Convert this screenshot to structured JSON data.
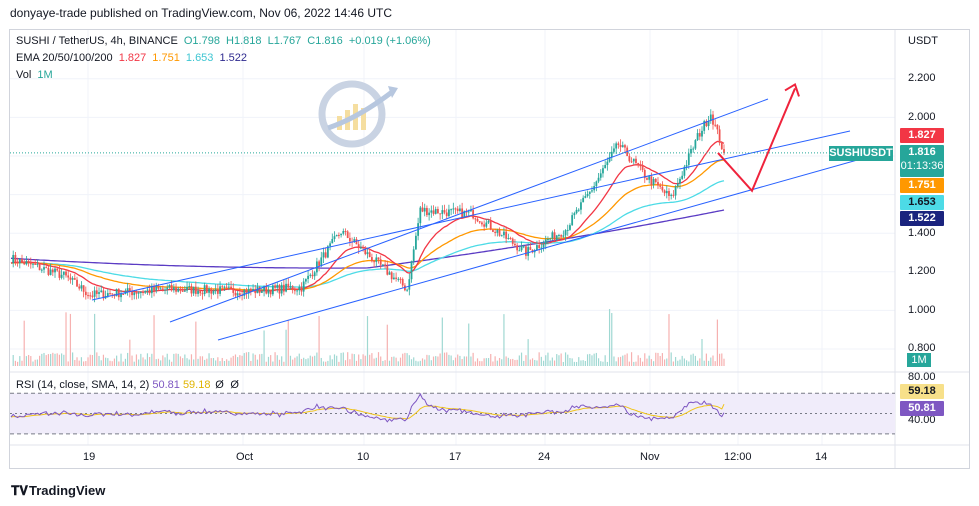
{
  "header": {
    "published": "donyaye-trade published on TradingView.com, Nov 06, 2022 14:46 UTC"
  },
  "legend": {
    "symbol": "SUSHI / TetherUS, 4h, BINANCE",
    "o": "O1.798",
    "h": "H1.818",
    "l": "L1.767",
    "c": "C1.816",
    "chg": "+0.019 (+1.06%)",
    "ema_label": "EMA 20/50/100/200",
    "ema20": "1.827",
    "ema50": "1.751",
    "ema100": "1.653",
    "ema200": "1.522",
    "vol_label": "Vol",
    "vol_value": "1M"
  },
  "rsi_legend": {
    "label": "RSI (14, close, SMA, 14, 2)",
    "rsi": "50.81",
    "sma": "59.18",
    "z1": "Ø",
    "z2": "Ø"
  },
  "price_axis": {
    "unit": "USDT",
    "ticks": [
      "2.200",
      "2.000",
      "1.400",
      "1.200",
      "1.000",
      "0.800"
    ]
  },
  "rsi_axis": {
    "ticks": [
      "80.00",
      "40.00"
    ]
  },
  "badges": {
    "ema20": "1.827",
    "symbol": "SUSHIUSDT",
    "price": "1.816",
    "countdown": "01:13:36",
    "ema50": "1.751",
    "ema100": "1.653",
    "ema200": "1.522",
    "rsi_sma": "59.18",
    "rsi": "50.81",
    "vol": "1M"
  },
  "time_axis": [
    "19",
    "Oct",
    "10",
    "17",
    "24",
    "Nov",
    "12:00",
    "14"
  ],
  "footer": {
    "brand": "TradingView"
  },
  "colors": {
    "up": "#26a69a",
    "down": "#ef5350",
    "ema20": "#f23645",
    "ema50": "#ff9800",
    "ema100": "#4ddbe6",
    "ema200": "#5b3cc4",
    "channel": "#2962ff",
    "rsi": "#7e57c2",
    "rsi_sma": "#f0c419"
  },
  "chart_data": {
    "type": "candlestick",
    "title": "SUSHI / TetherUS, 4h, BINANCE",
    "ylabel": "USDT",
    "ylim": [
      0.72,
      2.36
    ],
    "price_anchors": [
      {
        "t": "Sep 13",
        "p": 1.27
      },
      {
        "t": "Sep 17",
        "p": 1.18
      },
      {
        "t": "Sep 19",
        "p": 1.08
      },
      {
        "t": "Sep 25",
        "p": 1.11
      },
      {
        "t": "Oct 01",
        "p": 1.1
      },
      {
        "t": "Oct 05",
        "p": 1.12
      },
      {
        "t": "Oct 08",
        "p": 1.41
      },
      {
        "t": "Oct 11",
        "p": 1.23
      },
      {
        "t": "Oct 13",
        "p": 1.11
      },
      {
        "t": "Oct 14",
        "p": 1.52
      },
      {
        "t": "Oct 18",
        "p": 1.5
      },
      {
        "t": "Oct 22",
        "p": 1.3
      },
      {
        "t": "Oct 25",
        "p": 1.42
      },
      {
        "t": "Oct 27",
        "p": 1.63
      },
      {
        "t": "Oct 29",
        "p": 1.86
      },
      {
        "t": "Oct 31",
        "p": 1.7
      },
      {
        "t": "Nov 02",
        "p": 1.58
      },
      {
        "t": "Nov 04",
        "p": 1.9
      },
      {
        "t": "Nov 05",
        "p": 2.02
      },
      {
        "t": "Nov 06",
        "p": 1.816
      }
    ],
    "ema": [
      {
        "name": "EMA 20",
        "last": 1.827
      },
      {
        "name": "EMA 50",
        "last": 1.751
      },
      {
        "name": "EMA 100",
        "last": 1.653
      },
      {
        "name": "EMA 200",
        "last": 1.522
      }
    ],
    "projection": [
      1.816,
      1.62,
      2.15
    ],
    "rsi": {
      "last": 50.81,
      "sma": 59.18,
      "bands": [
        70,
        30
      ],
      "ylim": [
        20,
        85
      ]
    }
  }
}
